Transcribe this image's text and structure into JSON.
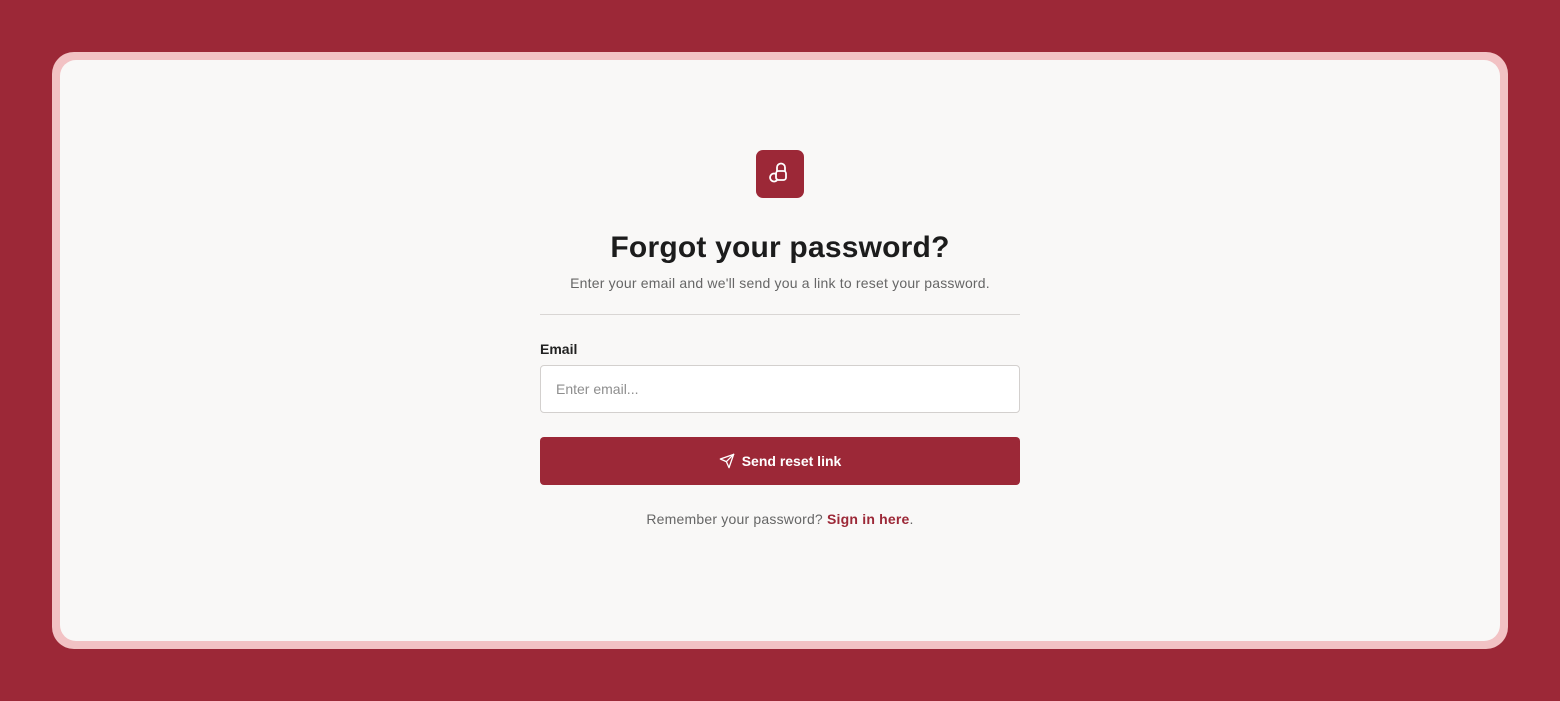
{
  "page": {
    "title": "Forgot your password?",
    "subtitle": "Enter your email and we'll send you a link to reset your password."
  },
  "form": {
    "email_label": "Email",
    "email_placeholder": "Enter email...",
    "email_value": "",
    "submit_label": "Send reset link"
  },
  "footer": {
    "prompt": "Remember your password?",
    "link_label": "Sign in here",
    "suffix": "."
  },
  "icons": {
    "logo": "padlock-logo-icon",
    "submit": "send-paper-plane-icon"
  },
  "colors": {
    "brand": "#9c2837",
    "frame": "#f2c2c4",
    "card": "#f9f8f7"
  }
}
